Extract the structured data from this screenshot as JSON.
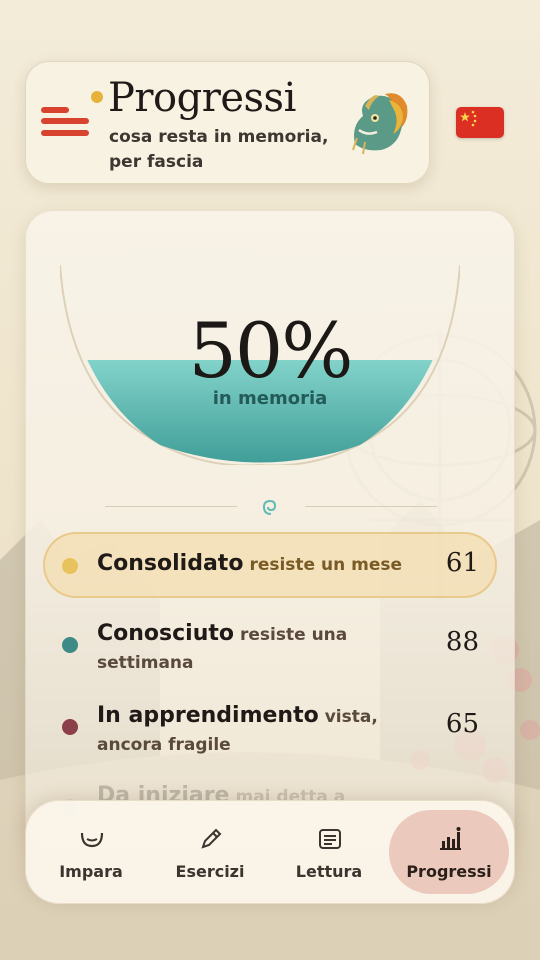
{
  "header": {
    "title": "Progressi",
    "subtitle": "cosa resta in memoria, per fascia"
  },
  "icons": {
    "menu": "menu-icon",
    "mascot": "dragon-icon",
    "language": "china-flag-icon",
    "divider_ornament": "spiral-icon"
  },
  "memory": {
    "percent_text": "50%",
    "fill_fraction": 0.5,
    "label": "in memoria"
  },
  "bands": [
    {
      "name": "Consolidato",
      "description": "resiste un mese",
      "count": "61",
      "color": "#e8c25c",
      "active": true
    },
    {
      "name": "Conosciuto",
      "description": "resiste una settimana",
      "count": "88",
      "color": "#3f8a86",
      "active": false
    },
    {
      "name": "In apprendimento",
      "description": "vista, ancora fragile",
      "count": "65",
      "color": "#8c3f4a",
      "active": false
    },
    {
      "name": "Da iniziare",
      "description": "mai detta a",
      "count": "",
      "color": "#b8a894",
      "active": false
    }
  ],
  "nav": [
    {
      "label": "Impara",
      "icon": "mouth-icon",
      "active": false
    },
    {
      "label": "Esercizi",
      "icon": "pencil-icon",
      "active": false
    },
    {
      "label": "Lettura",
      "icon": "reading-icon",
      "active": false
    },
    {
      "label": "Progressi",
      "icon": "bar-chart-icon",
      "active": true
    }
  ],
  "colors": {
    "accent_red": "#d8432f",
    "accent_gold": "#e6b23c",
    "water_teal": "#5fbcb4",
    "active_nav": "#ecc9bd"
  }
}
